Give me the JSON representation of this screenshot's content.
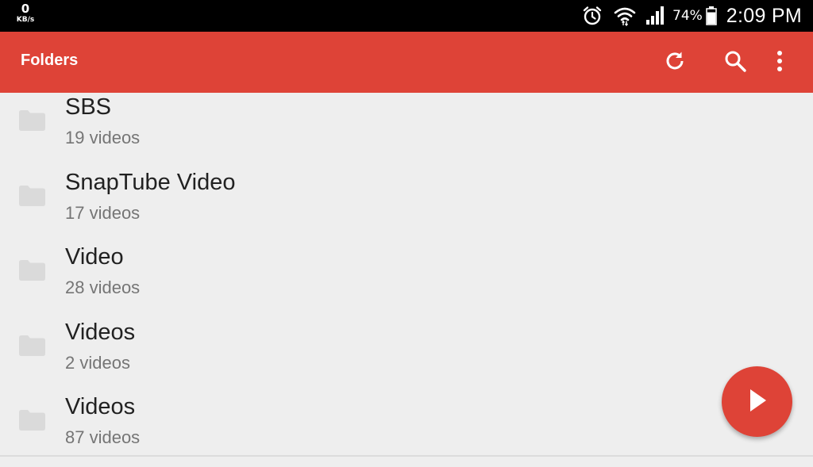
{
  "status_bar": {
    "net_speed_value": "0",
    "net_speed_unit": "KB/s",
    "battery_percent": "74%",
    "time": "2:09 PM",
    "icons": [
      "alarm-icon",
      "wifi-icon",
      "signal-icon",
      "battery-icon"
    ]
  },
  "app_bar": {
    "title": "Folders",
    "background": "#de4337",
    "actions": [
      "refresh-icon",
      "search-icon",
      "more-vert-icon"
    ]
  },
  "folders": [
    {
      "name": "SBS",
      "count": "19 videos"
    },
    {
      "name": "SnapTube Video",
      "count": "17 videos"
    },
    {
      "name": "Video",
      "count": "28 videos"
    },
    {
      "name": "Videos",
      "count": "2 videos"
    },
    {
      "name": "Videos",
      "count": "87 videos"
    }
  ],
  "fab": {
    "icon": "play-icon",
    "color": "#de4337"
  }
}
